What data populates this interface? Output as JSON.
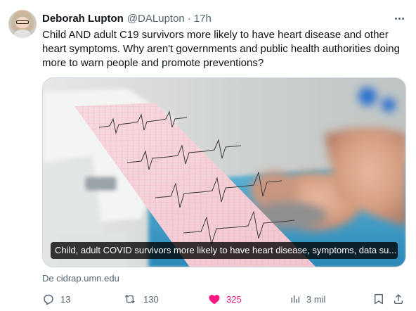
{
  "tweet": {
    "author_name": "Deborah Lupton",
    "handle": "@DALupton",
    "separator": "·",
    "time": "17h",
    "text": "Child AND adult C19 survivors more likely to have heart disease and other heart symptoms. Why aren't governments and public health authorities doing more to warn people and promote preventions?",
    "link_card": {
      "caption": "Child, adult COVID survivors more likely to have heart disease, symptoms, data su...",
      "source": "De cidrap.umn.edu"
    },
    "actions": {
      "replies": "13",
      "reposts": "130",
      "likes": "325",
      "views": "3 mil"
    }
  },
  "colors": {
    "text_primary": "#0f1419",
    "text_secondary": "#536471",
    "like_active": "#f91880",
    "border": "#cfd9de"
  },
  "icons": [
    "more-icon",
    "reply-icon",
    "repost-icon",
    "heart-icon",
    "views-icon",
    "bookmark-icon",
    "share-icon"
  ]
}
